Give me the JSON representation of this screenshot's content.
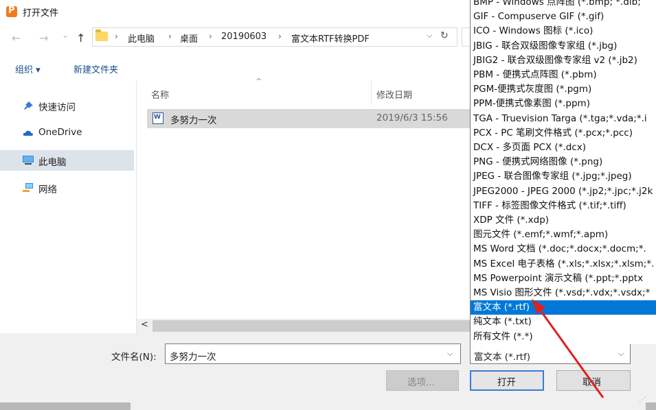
{
  "window": {
    "title": "打开文件"
  },
  "nav": {
    "back": "←",
    "forward": "→",
    "recent": "⌄",
    "up": "↑"
  },
  "breadcrumb": [
    "此电脑",
    "桌面",
    "20190603",
    "富文本RTF转换PDF"
  ],
  "breadcrumb_separator": "›",
  "toolbar": {
    "organize": "组织 ▾",
    "new_folder": "新建文件夹"
  },
  "sidebar": {
    "items": [
      {
        "label": "快速访问",
        "icon": "pin-icon",
        "color": "#2e7bd6"
      },
      {
        "label": "OneDrive",
        "icon": "cloud-icon",
        "color": "#1e6fc2"
      },
      {
        "label": "此电脑",
        "icon": "computer-icon",
        "color": "#2a8fe0"
      },
      {
        "label": "网络",
        "icon": "network-icon",
        "color": "#2a8fe0"
      }
    ]
  },
  "file_list": {
    "columns": {
      "name": "名称",
      "date": "修改日期"
    },
    "rows": [
      {
        "name": "多努力一次",
        "date": "2019/6/3 15:56",
        "icon": "word-doc-icon"
      }
    ]
  },
  "footer": {
    "filename_label": "文件名(N):",
    "filename_value": "多努力一次",
    "filetype_value": "富文本 (*.rtf)",
    "options_label": "选项...",
    "open_label": "打开",
    "cancel_label": "取消"
  },
  "filetype_dropdown": {
    "items": [
      "BMP - Windows 点阵图 (*.bmp; *.dib;",
      "GIF - Compuserve GIF (*.gif)",
      "ICO - Windows 图标 (*.ico)",
      "JBIG - 联合双级图像专家组 (*.jbg)",
      "JBIG2 - 联合双级图像专家组 v2 (*.jb2)",
      "PBM - 便携式点阵图 (*.pbm)",
      "PGM-便携式灰度图 (*.pgm)",
      "PPM-便携式像素图 (*.ppm)",
      "TGA - Truevision Targa (*.tga;*.vda;*.i",
      "PCX - PC 笔刷文件格式 (*.pcx;*.pcc)",
      "DCX - 多页面 PCX (*.dcx)",
      "PNG - 便携式网络图像 (*.png)",
      "JPEG - 联合图像专家组 (*.jpg;*.jpeg)",
      "JPEG2000 - JPEG 2000 (*.jp2;*.jpc;*.j2k",
      "TIFF - 标签图像文件格式 (*.tif;*.tiff)",
      "XDP 文件 (*.xdp)",
      "图元文件 (*.emf;*.wmf;*.apm)",
      "MS Word 文档 (*.doc;*.docx;*.docm;*.",
      "MS Excel 电子表格 (*.xls;*.xlsx;*.xlsm;*.",
      "MS Powerpoint 演示文稿 (*.ppt;*.pptx",
      "MS Visio 图形文件 (*.vsd;*.vdx;*.vsdx;*",
      "富文本 (*.rtf)",
      "纯文本 (*.txt)",
      "所有文件 (*.*)"
    ],
    "selected_index": 21
  },
  "colors": {
    "selection": "#0078d7",
    "annotation_arrow": "#e02020"
  }
}
